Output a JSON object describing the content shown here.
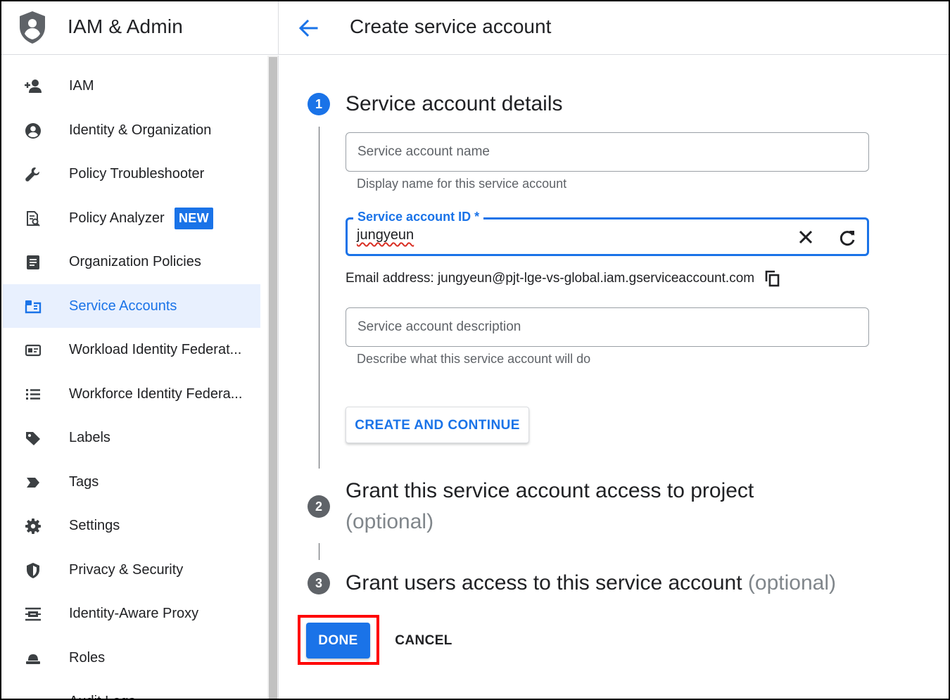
{
  "app": {
    "title": "IAM & Admin"
  },
  "header": {
    "title": "Create service account"
  },
  "sidebar": {
    "items": [
      {
        "label": "IAM",
        "icon": "person-add-icon"
      },
      {
        "label": "Identity & Organization",
        "icon": "account-circle-icon"
      },
      {
        "label": "Policy Troubleshooter",
        "icon": "wrench-icon"
      },
      {
        "label": "Policy Analyzer",
        "icon": "policy-analyzer-icon",
        "badge": "NEW"
      },
      {
        "label": "Organization Policies",
        "icon": "document-list-icon"
      },
      {
        "label": "Service Accounts",
        "icon": "service-account-icon",
        "active": true
      },
      {
        "label": "Workload Identity Federat...",
        "icon": "id-card-icon"
      },
      {
        "label": "Workforce Identity Federa...",
        "icon": "list-icon"
      },
      {
        "label": "Labels",
        "icon": "label-tag-icon"
      },
      {
        "label": "Tags",
        "icon": "tag-arrow-icon"
      },
      {
        "label": "Settings",
        "icon": "gear-icon"
      },
      {
        "label": "Privacy & Security",
        "icon": "shield-icon"
      },
      {
        "label": "Identity-Aware Proxy",
        "icon": "proxy-icon"
      },
      {
        "label": "Roles",
        "icon": "hat-icon"
      },
      {
        "label": "Audit Logs",
        "icon": "menu-lines-icon"
      }
    ]
  },
  "steps": [
    {
      "number": "1",
      "title": "Service account details",
      "optional": ""
    },
    {
      "number": "2",
      "title": "Grant this service account access to project",
      "optional": "(optional)"
    },
    {
      "number": "3",
      "title": "Grant users access to this service account",
      "optional": "(optional)"
    }
  ],
  "form": {
    "name": {
      "placeholder": "Service account name",
      "value": "",
      "helper": "Display name for this service account"
    },
    "id": {
      "label": "Service account ID *",
      "value": "jungyeun"
    },
    "email_label": "Email address: jungyeun@pjt-lge-vs-global.iam.gserviceaccount.com",
    "description": {
      "placeholder": "Service account description",
      "value": "",
      "helper": "Describe what this service account will do"
    },
    "create_button": "CREATE AND CONTINUE"
  },
  "actions": {
    "done": "DONE",
    "cancel": "CANCEL"
  },
  "colors": {
    "accent": "#1a73e8",
    "highlight": "#ff0000",
    "active_bg": "#e8f0fe"
  }
}
